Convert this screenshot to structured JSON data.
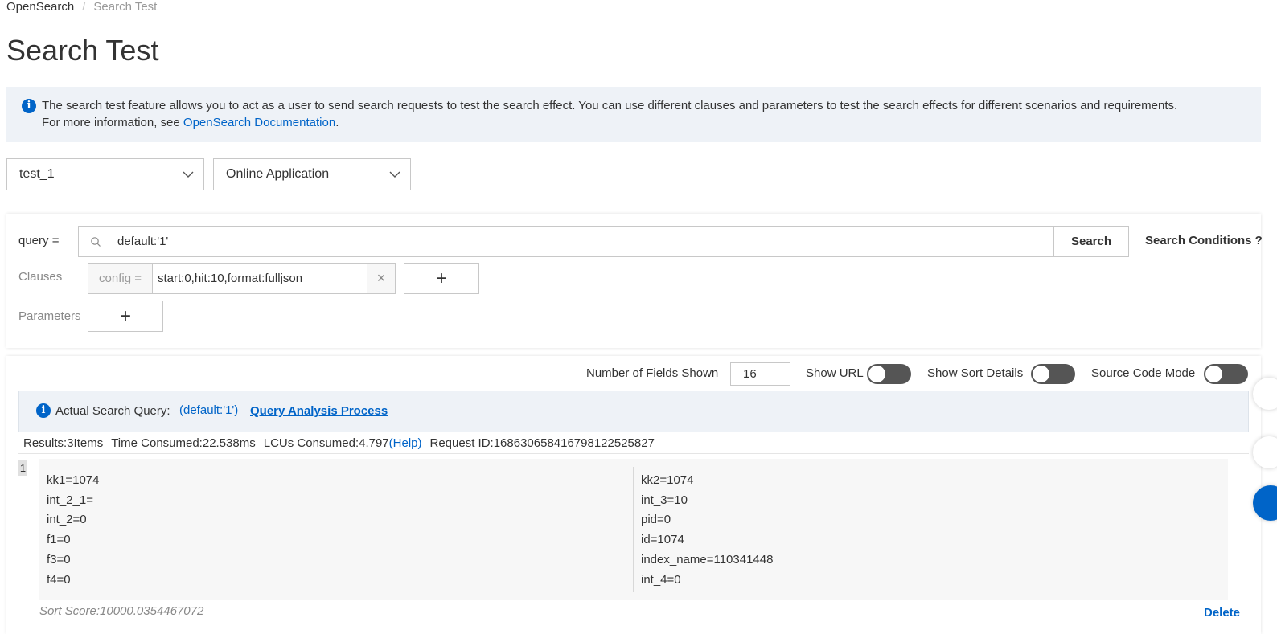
{
  "breadcrumb": {
    "root": "OpenSearch",
    "separator": "/",
    "current": "Search Test"
  },
  "page_title": "Search Test",
  "info": {
    "text_line1": "The search test feature allows you to act as a user to send search requests to test the search effect. You can use different clauses and parameters to test the search effects for different scenarios and requirements.",
    "text_line2_prefix": "For more information, see ",
    "link": "OpenSearch Documentation",
    "text_line2_suffix": "."
  },
  "selectors": {
    "app": "test_1",
    "version": "Online Application"
  },
  "query": {
    "label": "query =",
    "value": "default:'1'",
    "search_button": "Search",
    "conditions": "Search Conditions ?"
  },
  "clauses": {
    "label": "Clauses",
    "addon": "config =",
    "value": "start:0,hit:10,format:fulljson",
    "clear": "×",
    "add": "+"
  },
  "parameters": {
    "label": "Parameters",
    "add": "+"
  },
  "options": {
    "fields_label": "Number of Fields Shown",
    "fields_value": "16",
    "show_url": "Show URL",
    "show_sort": "Show Sort Details",
    "source_mode": "Source Code Mode"
  },
  "actual_query": {
    "label": "Actual Search Query:",
    "value": "(default:'1')",
    "link": "Query Analysis Process"
  },
  "stats": {
    "results": "Results:3Items",
    "time": "Time Consumed:22.538ms",
    "lcu": "LCUs Consumed:4.797",
    "help": "(Help)",
    "request": "Request ID:168630658416798122525827"
  },
  "result": {
    "index": "1",
    "left_fields": [
      "kk1=1074",
      "int_2_1=",
      "int_2=0",
      "f1=0",
      "f3=0",
      "f4=0"
    ],
    "right_fields": [
      "kk2=1074",
      "int_3=10",
      "pid=0",
      "id=1074",
      "index_name=110341448",
      "int_4=0"
    ],
    "sort_score": "Sort Score:10000.0354467072",
    "delete": "Delete"
  }
}
